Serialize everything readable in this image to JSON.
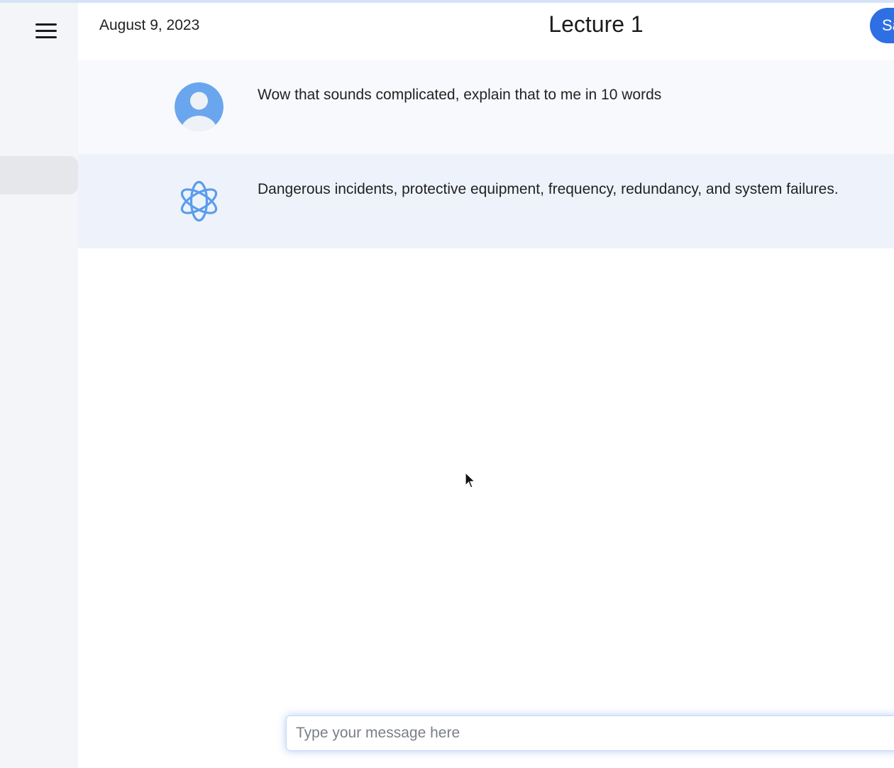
{
  "header": {
    "date": "August 9, 2023",
    "title": "Lecture 1",
    "button_label": "Save"
  },
  "messages": [
    {
      "role": "user",
      "avatar_icon": "user-avatar-icon",
      "text": "Wow that sounds complicated, explain that to me in 10 words"
    },
    {
      "role": "assistant",
      "avatar_icon": "openai-logo-icon",
      "text": "Dangerous incidents, protective equipment, frequency, redundancy, and system failures."
    }
  ],
  "composer": {
    "placeholder": "Type your message here",
    "value": ""
  },
  "icons": {
    "menu": "hamburger-menu-icon",
    "pointer": "mouse-pointer-icon"
  },
  "colors": {
    "accent": "#2f6fe4",
    "avatar_blue": "#6aa6ee",
    "sidebar_bg": "#f4f5f8",
    "user_row_bg": "#f7f9fc",
    "assistant_row_bg": "#eef3fb"
  }
}
